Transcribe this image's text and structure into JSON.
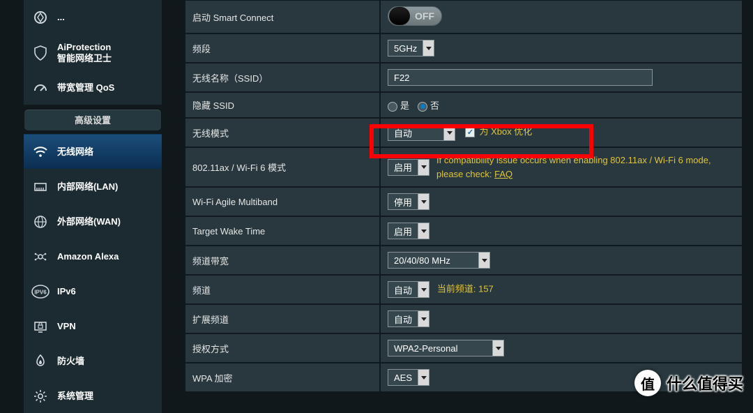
{
  "sidebar": {
    "topItems": [
      {
        "label": "...",
        "sub": ""
      },
      {
        "label": "AiProtection",
        "sub": "智能网络卫士"
      },
      {
        "label": "带宽管理 QoS",
        "sub": ""
      }
    ],
    "sectionHeader": "高级设置",
    "advItems": [
      "无线网络",
      "内部网络(LAN)",
      "外部网络(WAN)",
      "Amazon Alexa",
      "IPv6",
      "VPN",
      "防火墙",
      "系统管理"
    ]
  },
  "rows": {
    "smart_connect": {
      "label": "启动 Smart Connect",
      "toggle": "OFF"
    },
    "band": {
      "label": "频段",
      "value": "5GHz"
    },
    "ssid": {
      "label": "无线名称（SSID）",
      "value": "F22"
    },
    "hide_ssid": {
      "label": "隐藏 SSID",
      "yes": "是",
      "no": "否"
    },
    "mode": {
      "label": "无线模式",
      "value": "自动",
      "xbox": "为 Xbox 优化"
    },
    "ax": {
      "label": "802.11ax / Wi-Fi 6 模式",
      "value": "启用",
      "note1": "If compatibility issue occurs when enabling 802.11ax / Wi-Fi 6 mode,",
      "note2": "please check:",
      "faq": "FAQ"
    },
    "agile": {
      "label": "Wi-Fi Agile Multiband",
      "value": "停用"
    },
    "twt": {
      "label": "Target Wake Time",
      "value": "启用"
    },
    "bw": {
      "label": "频道带宽",
      "value": "20/40/80 MHz"
    },
    "channel": {
      "label": "频道",
      "value": "自动",
      "cur": "当前频道: 157"
    },
    "ext": {
      "label": "扩展频道",
      "value": "自动"
    },
    "auth": {
      "label": "授权方式",
      "value": "WPA2-Personal"
    },
    "wpa": {
      "label": "WPA 加密",
      "value": "AES"
    }
  },
  "watermark": {
    "badge": "值",
    "text": "什么值得买"
  }
}
